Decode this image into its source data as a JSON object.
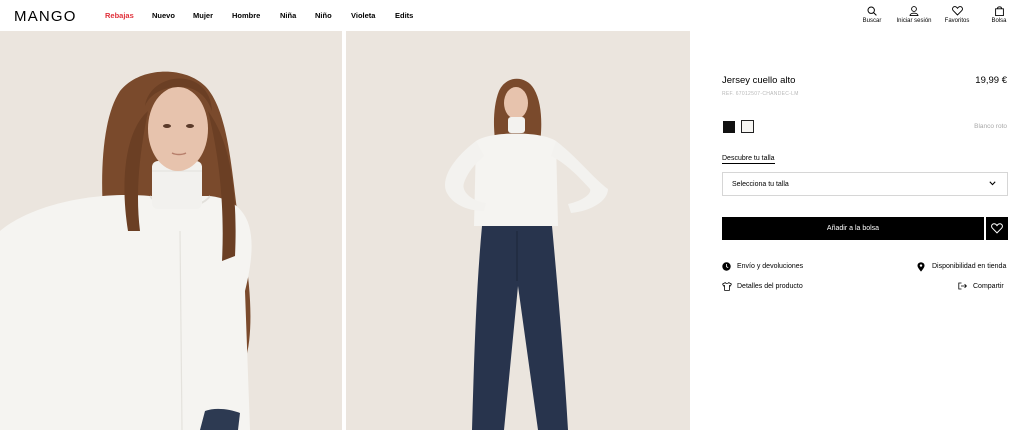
{
  "header": {
    "logo": "MANGO",
    "nav": [
      {
        "label": "Rebajas",
        "sale": true
      },
      {
        "label": "Nuevo"
      },
      {
        "label": "Mujer"
      },
      {
        "label": "Hombre"
      },
      {
        "label": "Niña"
      },
      {
        "label": "Niño"
      },
      {
        "label": "Violeta"
      },
      {
        "label": "Edits"
      }
    ],
    "tools": {
      "search": {
        "label": "Buscar",
        "icon": "search-icon"
      },
      "login": {
        "label": "Iniciar sesión",
        "icon": "user-icon"
      },
      "favorites": {
        "label": "Favoritos",
        "icon": "heart-icon"
      },
      "bag": {
        "label": "Bolsa",
        "icon": "bag-icon"
      }
    }
  },
  "product": {
    "title": "Jersey cuello alto",
    "price": "19,99 €",
    "ref": "REF. 67012507-CHANDEC-LM",
    "colors": [
      {
        "name": "Negro",
        "hex": "#111111"
      },
      {
        "name": "Blanco roto",
        "hex": "#f7f6f3",
        "selected": true
      }
    ],
    "selected_color_label": "Blanco roto",
    "size_guide_label": "Descubre tu talla",
    "size_select_placeholder": "Selecciona tu talla",
    "add_to_bag_label": "Añadir a la bolsa",
    "links": {
      "shipping": "Envío y devoluciones",
      "availability": "Disponibilidad en tienda",
      "details": "Detalles del producto",
      "share": "Compartir"
    }
  },
  "colors": {
    "sale": "#e0303a",
    "background_photo": "#ece6df",
    "button": "#000000"
  }
}
